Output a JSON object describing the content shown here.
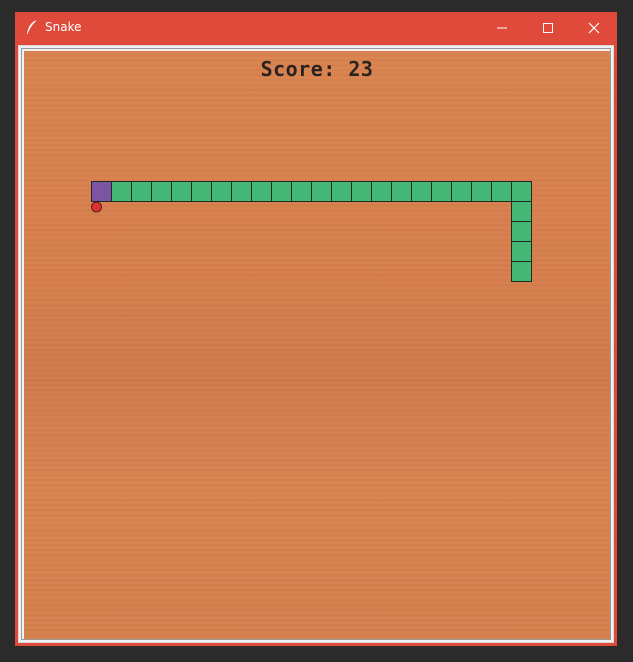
{
  "window": {
    "title": "Snake"
  },
  "score": {
    "text": "Score: 23"
  },
  "game": {
    "grid_cols": 29,
    "grid_rows": 29,
    "snake_head": [
      3,
      6
    ],
    "snake_body": [
      [
        4,
        6
      ],
      [
        5,
        6
      ],
      [
        6,
        6
      ],
      [
        7,
        6
      ],
      [
        8,
        6
      ],
      [
        9,
        6
      ],
      [
        10,
        6
      ],
      [
        11,
        6
      ],
      [
        12,
        6
      ],
      [
        13,
        6
      ],
      [
        14,
        6
      ],
      [
        15,
        6
      ],
      [
        16,
        6
      ],
      [
        17,
        6
      ],
      [
        18,
        6
      ],
      [
        19,
        6
      ],
      [
        20,
        6
      ],
      [
        21,
        6
      ],
      [
        22,
        6
      ],
      [
        23,
        6
      ],
      [
        24,
        6
      ],
      [
        24,
        7
      ],
      [
        24,
        8
      ],
      [
        24,
        9
      ],
      [
        24,
        10
      ]
    ],
    "food": [
      3,
      7
    ],
    "colors": {
      "head": "#7a55a3",
      "body": "#45b877",
      "outline": "#1e2a20",
      "food": "#dd3030",
      "board": "#d9804f",
      "titlebar": "#e04a3a"
    }
  },
  "icons": {
    "app": "feather-icon",
    "minimize": "minimize-icon",
    "maximize": "maximize-icon",
    "close": "close-icon"
  }
}
